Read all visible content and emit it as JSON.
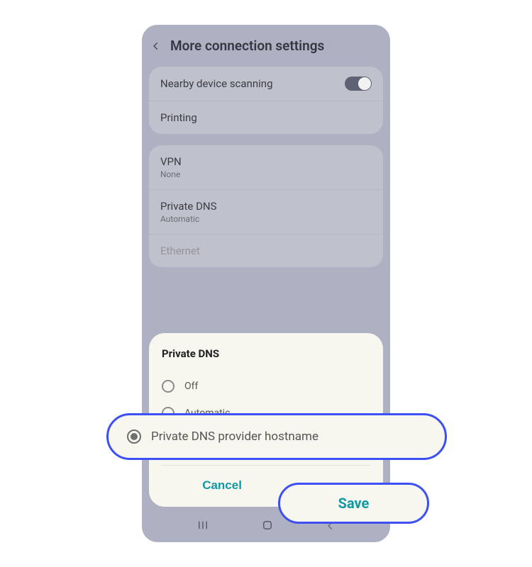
{
  "header": {
    "title": "More connection settings"
  },
  "section1": {
    "nearby": {
      "label": "Nearby device scanning"
    },
    "printing": {
      "label": "Printing"
    }
  },
  "section2": {
    "vpn": {
      "label": "VPN",
      "sub": "None"
    },
    "pdns": {
      "label": "Private DNS",
      "sub": "Automatic"
    },
    "ethernet": {
      "label": "Ethernet"
    }
  },
  "modal": {
    "title": "Private DNS",
    "opt_off": "Off",
    "opt_auto": "Automatic",
    "opt_host": "Private DNS provider hostname",
    "cancel": "Cancel",
    "save": "Save"
  }
}
